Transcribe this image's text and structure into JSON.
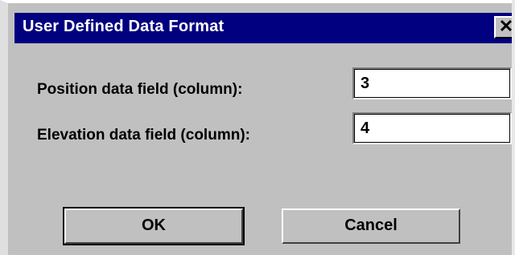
{
  "dialog": {
    "title": "User Defined Data Format",
    "close_glyph": "✕"
  },
  "fields": [
    {
      "label": "Position data field (column):",
      "value": "3"
    },
    {
      "label": "Elevation data field (column):",
      "value": "4"
    }
  ],
  "buttons": {
    "ok": "OK",
    "cancel": "Cancel"
  },
  "colors": {
    "titlebar": "#000080",
    "face": "#c0c0c0"
  }
}
